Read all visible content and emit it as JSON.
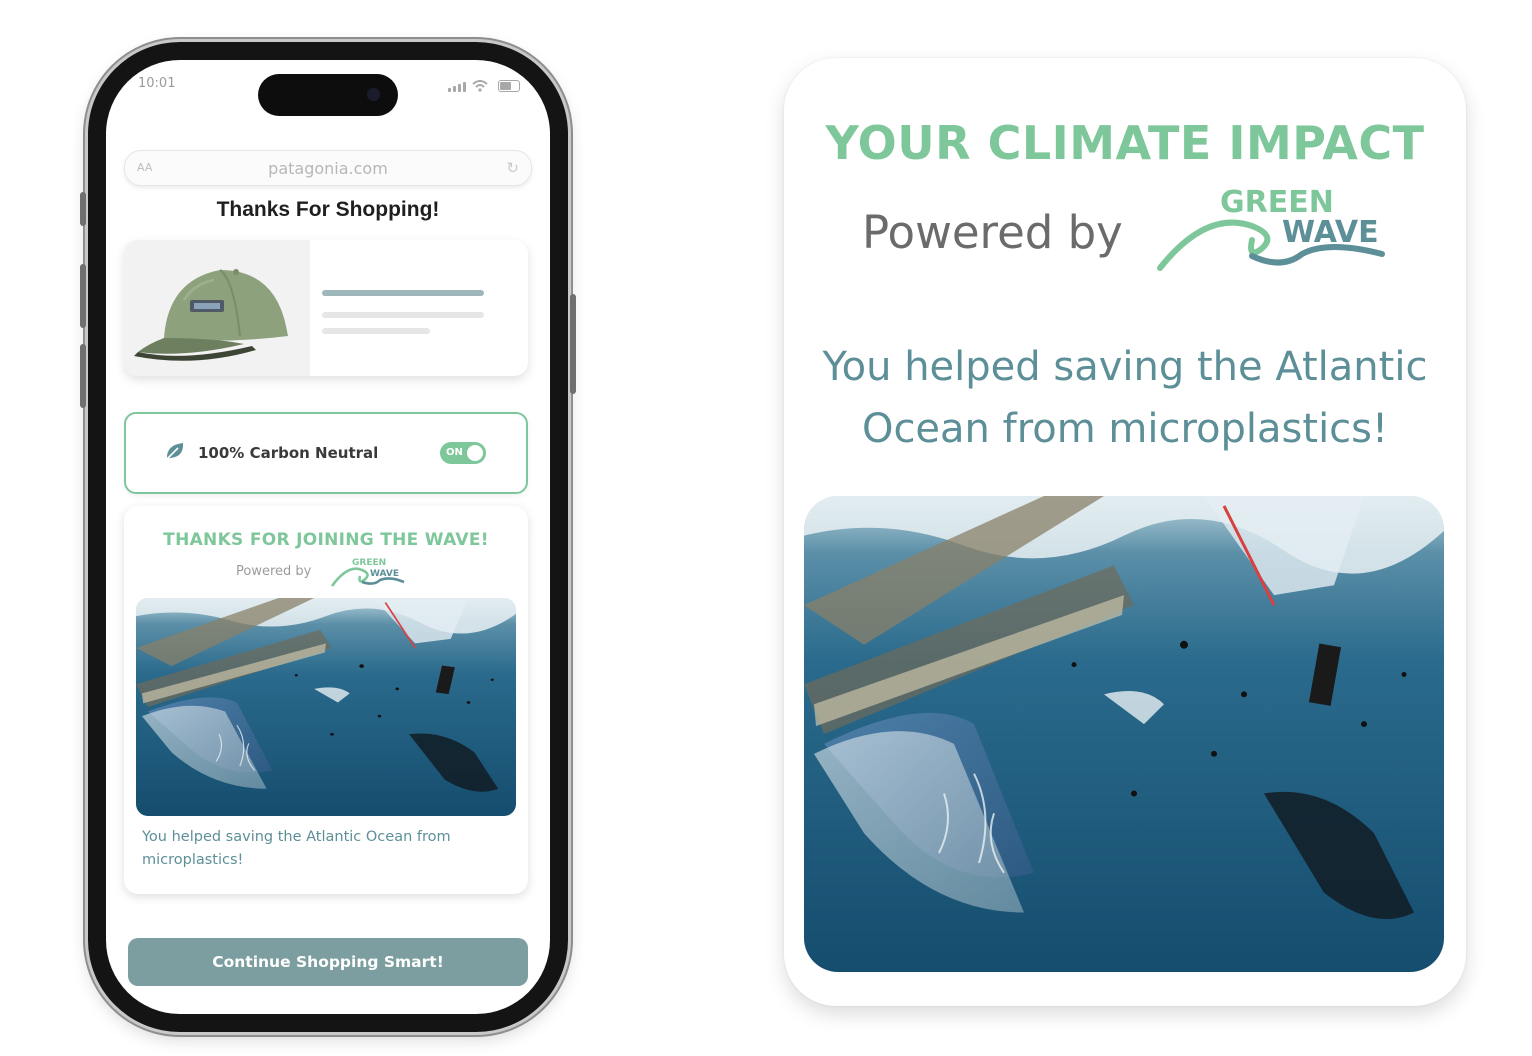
{
  "status_bar": {
    "time": "10:01"
  },
  "browser": {
    "url": "patagonia.com",
    "text_size_label": "AA"
  },
  "confirmation": {
    "title": "Thanks For Shopping!"
  },
  "carbon_option": {
    "label": "100% Carbon Neutral",
    "toggle_state": "ON"
  },
  "wave_card": {
    "title": "THANKS FOR JOINING THE WAVE!",
    "powered_by": "Powered by",
    "logo_line1": "GREEN",
    "logo_line2": "WAVE",
    "message": "You helped saving the Atlantic Ocean from microplastics!"
  },
  "cta": {
    "label": "Continue Shopping Smart!"
  },
  "impact_card": {
    "title": "YOUR CLIMATE IMPACT",
    "powered_by": "Powered by",
    "logo_line1": "GREEN",
    "logo_line2": "WAVE",
    "message_line1": "You helped saving the Atlantic",
    "message_line2": "Ocean from microplastics!"
  },
  "colors": {
    "accent_green": "#7ec79a",
    "teal_text": "#5d8f98",
    "cta_background": "#7c9ea0",
    "ocean_blue": "#1f5f80"
  }
}
